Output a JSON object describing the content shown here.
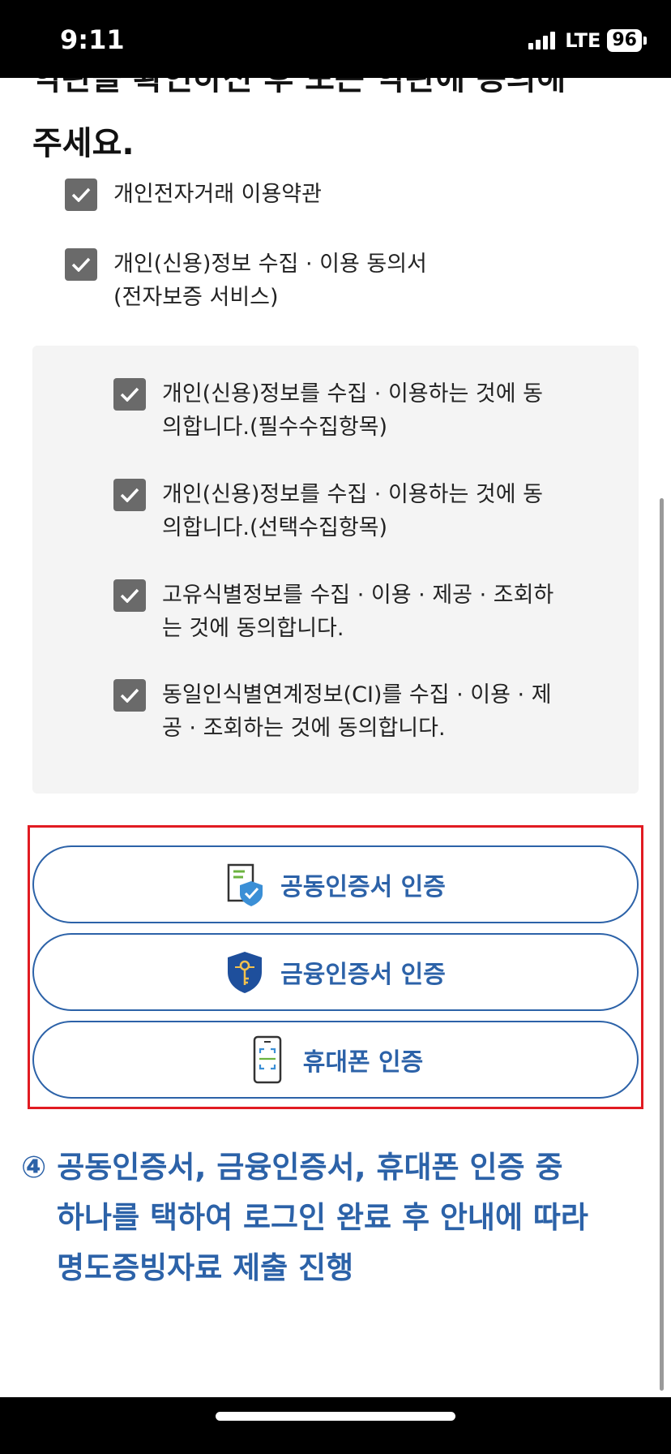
{
  "status": {
    "time": "9:11",
    "network": "LTE",
    "battery": "96"
  },
  "terms": {
    "heading_cut": "약관을 확인하신 후 모든 약관에 동의해",
    "heading": "주세요.",
    "items": [
      {
        "label": "개인전자거래 이용약관",
        "checked": true
      },
      {
        "label_line1": "개인(신용)정보 수집 · 이용 동의서",
        "label_line2": "(전자보증 서비스)",
        "checked": true
      }
    ],
    "sub_items": [
      {
        "line1": "개인(신용)정보를 수집 · 이용하는 것에 동",
        "line2": "의합니다.(필수수집항목)",
        "checked": true
      },
      {
        "line1": "개인(신용)정보를 수집 · 이용하는 것에 동",
        "line2": "의합니다.(선택수집항목)",
        "checked": true
      },
      {
        "line1": "고유식별정보를 수집 · 이용 · 제공 · 조회하",
        "line2": "는 것에 동의합니다.",
        "checked": true
      },
      {
        "line1": "동일인식별연계정보(CI)를 수집 · 이용 · 제",
        "line2": "공 · 조회하는 것에 동의합니다.",
        "checked": true
      }
    ]
  },
  "auth": {
    "buttons": [
      {
        "label": "공동인증서 인증",
        "icon": "certificate-document-icon"
      },
      {
        "label": "금융인증서 인증",
        "icon": "key-shield-icon"
      },
      {
        "label": "휴대폰 인증",
        "icon": "mobile-phone-icon"
      }
    ]
  },
  "instruction": {
    "line1": "④ 공동인증서, 금융인증서, 휴대폰 인증 중",
    "line2": "하나를 택하여 로그인 완료 후 안내에 따라",
    "line3": "명도증빙자료 제출 진행"
  },
  "colors": {
    "accent_blue": "#2c62a8",
    "highlight_red": "#e11b22",
    "checkbox_gray": "#6a6a6a"
  }
}
